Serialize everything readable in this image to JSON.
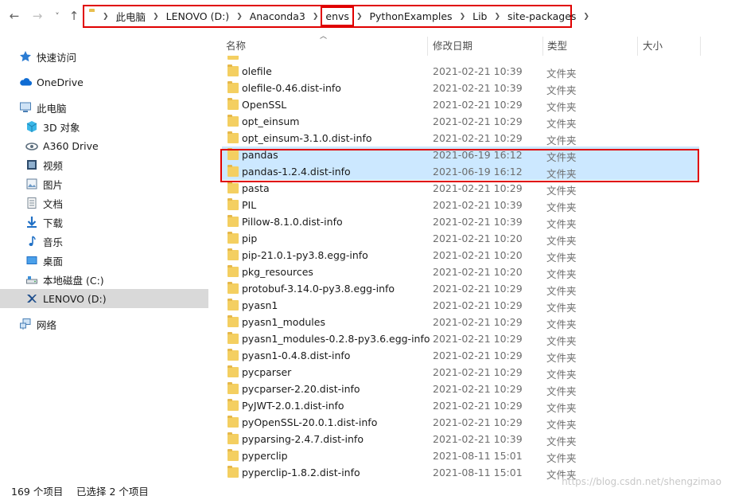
{
  "address": {
    "breadcrumbs": [
      "此电脑",
      "LENOVO (D:)",
      "Anaconda3",
      "envs",
      "PythonExamples",
      "Lib",
      "site-packages"
    ]
  },
  "nav": {
    "back": "←",
    "forward": "→",
    "recent": "˅",
    "up": "↑"
  },
  "sidebar": {
    "items": [
      {
        "label": "快速访问",
        "icon": "star-icon"
      },
      {
        "label": "OneDrive",
        "icon": "cloud-icon"
      },
      {
        "label": "此电脑",
        "icon": "computer-icon"
      },
      {
        "label": "3D 对象",
        "icon": "cube-icon"
      },
      {
        "label": "A360 Drive",
        "icon": "a360-icon"
      },
      {
        "label": "视频",
        "icon": "video-icon"
      },
      {
        "label": "图片",
        "icon": "picture-icon"
      },
      {
        "label": "文档",
        "icon": "document-icon"
      },
      {
        "label": "下载",
        "icon": "download-icon"
      },
      {
        "label": "音乐",
        "icon": "music-icon"
      },
      {
        "label": "桌面",
        "icon": "desktop-icon"
      },
      {
        "label": "本地磁盘 (C:)",
        "icon": "drive-icon"
      },
      {
        "label": "LENOVO (D:)",
        "icon": "lenovo-drive-icon"
      },
      {
        "label": "网络",
        "icon": "network-icon"
      }
    ]
  },
  "columns": {
    "name": "名称",
    "date": "修改日期",
    "type": "类型",
    "size": "大小"
  },
  "files": [
    {
      "name": "olefile",
      "date": "2021-02-21 10:39",
      "type": "文件夹"
    },
    {
      "name": "olefile-0.46.dist-info",
      "date": "2021-02-21 10:39",
      "type": "文件夹"
    },
    {
      "name": "OpenSSL",
      "date": "2021-02-21 10:29",
      "type": "文件夹"
    },
    {
      "name": "opt_einsum",
      "date": "2021-02-21 10:29",
      "type": "文件夹"
    },
    {
      "name": "opt_einsum-3.1.0.dist-info",
      "date": "2021-02-21 10:29",
      "type": "文件夹"
    },
    {
      "name": "pandas",
      "date": "2021-06-19 16:12",
      "type": "文件夹",
      "selected": true
    },
    {
      "name": "pandas-1.2.4.dist-info",
      "date": "2021-06-19 16:12",
      "type": "文件夹",
      "selected": true
    },
    {
      "name": "pasta",
      "date": "2021-02-21 10:29",
      "type": "文件夹"
    },
    {
      "name": "PIL",
      "date": "2021-02-21 10:39",
      "type": "文件夹"
    },
    {
      "name": "Pillow-8.1.0.dist-info",
      "date": "2021-02-21 10:39",
      "type": "文件夹"
    },
    {
      "name": "pip",
      "date": "2021-02-21 10:20",
      "type": "文件夹"
    },
    {
      "name": "pip-21.0.1-py3.8.egg-info",
      "date": "2021-02-21 10:20",
      "type": "文件夹"
    },
    {
      "name": "pkg_resources",
      "date": "2021-02-21 10:20",
      "type": "文件夹"
    },
    {
      "name": "protobuf-3.14.0-py3.8.egg-info",
      "date": "2021-02-21 10:29",
      "type": "文件夹"
    },
    {
      "name": "pyasn1",
      "date": "2021-02-21 10:29",
      "type": "文件夹"
    },
    {
      "name": "pyasn1_modules",
      "date": "2021-02-21 10:29",
      "type": "文件夹"
    },
    {
      "name": "pyasn1_modules-0.2.8-py3.6.egg-info",
      "date": "2021-02-21 10:29",
      "type": "文件夹"
    },
    {
      "name": "pyasn1-0.4.8.dist-info",
      "date": "2021-02-21 10:29",
      "type": "文件夹"
    },
    {
      "name": "pycparser",
      "date": "2021-02-21 10:29",
      "type": "文件夹"
    },
    {
      "name": "pycparser-2.20.dist-info",
      "date": "2021-02-21 10:29",
      "type": "文件夹"
    },
    {
      "name": "PyJWT-2.0.1.dist-info",
      "date": "2021-02-21 10:29",
      "type": "文件夹"
    },
    {
      "name": "pyOpenSSL-20.0.1.dist-info",
      "date": "2021-02-21 10:29",
      "type": "文件夹"
    },
    {
      "name": "pyparsing-2.4.7.dist-info",
      "date": "2021-02-21 10:39",
      "type": "文件夹"
    },
    {
      "name": "pyperclip",
      "date": "2021-08-11 15:01",
      "type": "文件夹"
    },
    {
      "name": "pyperclip-1.8.2.dist-info",
      "date": "2021-08-11 15:01",
      "type": "文件夹"
    }
  ],
  "status": {
    "count": "169 个项目",
    "selected": "已选择 2 个项目"
  },
  "watermark": "https://blog.csdn.net/shengzimao",
  "colors": {
    "selection": "#cce8ff",
    "annotation_red": "#e00000",
    "folder": "#f4cf61"
  }
}
